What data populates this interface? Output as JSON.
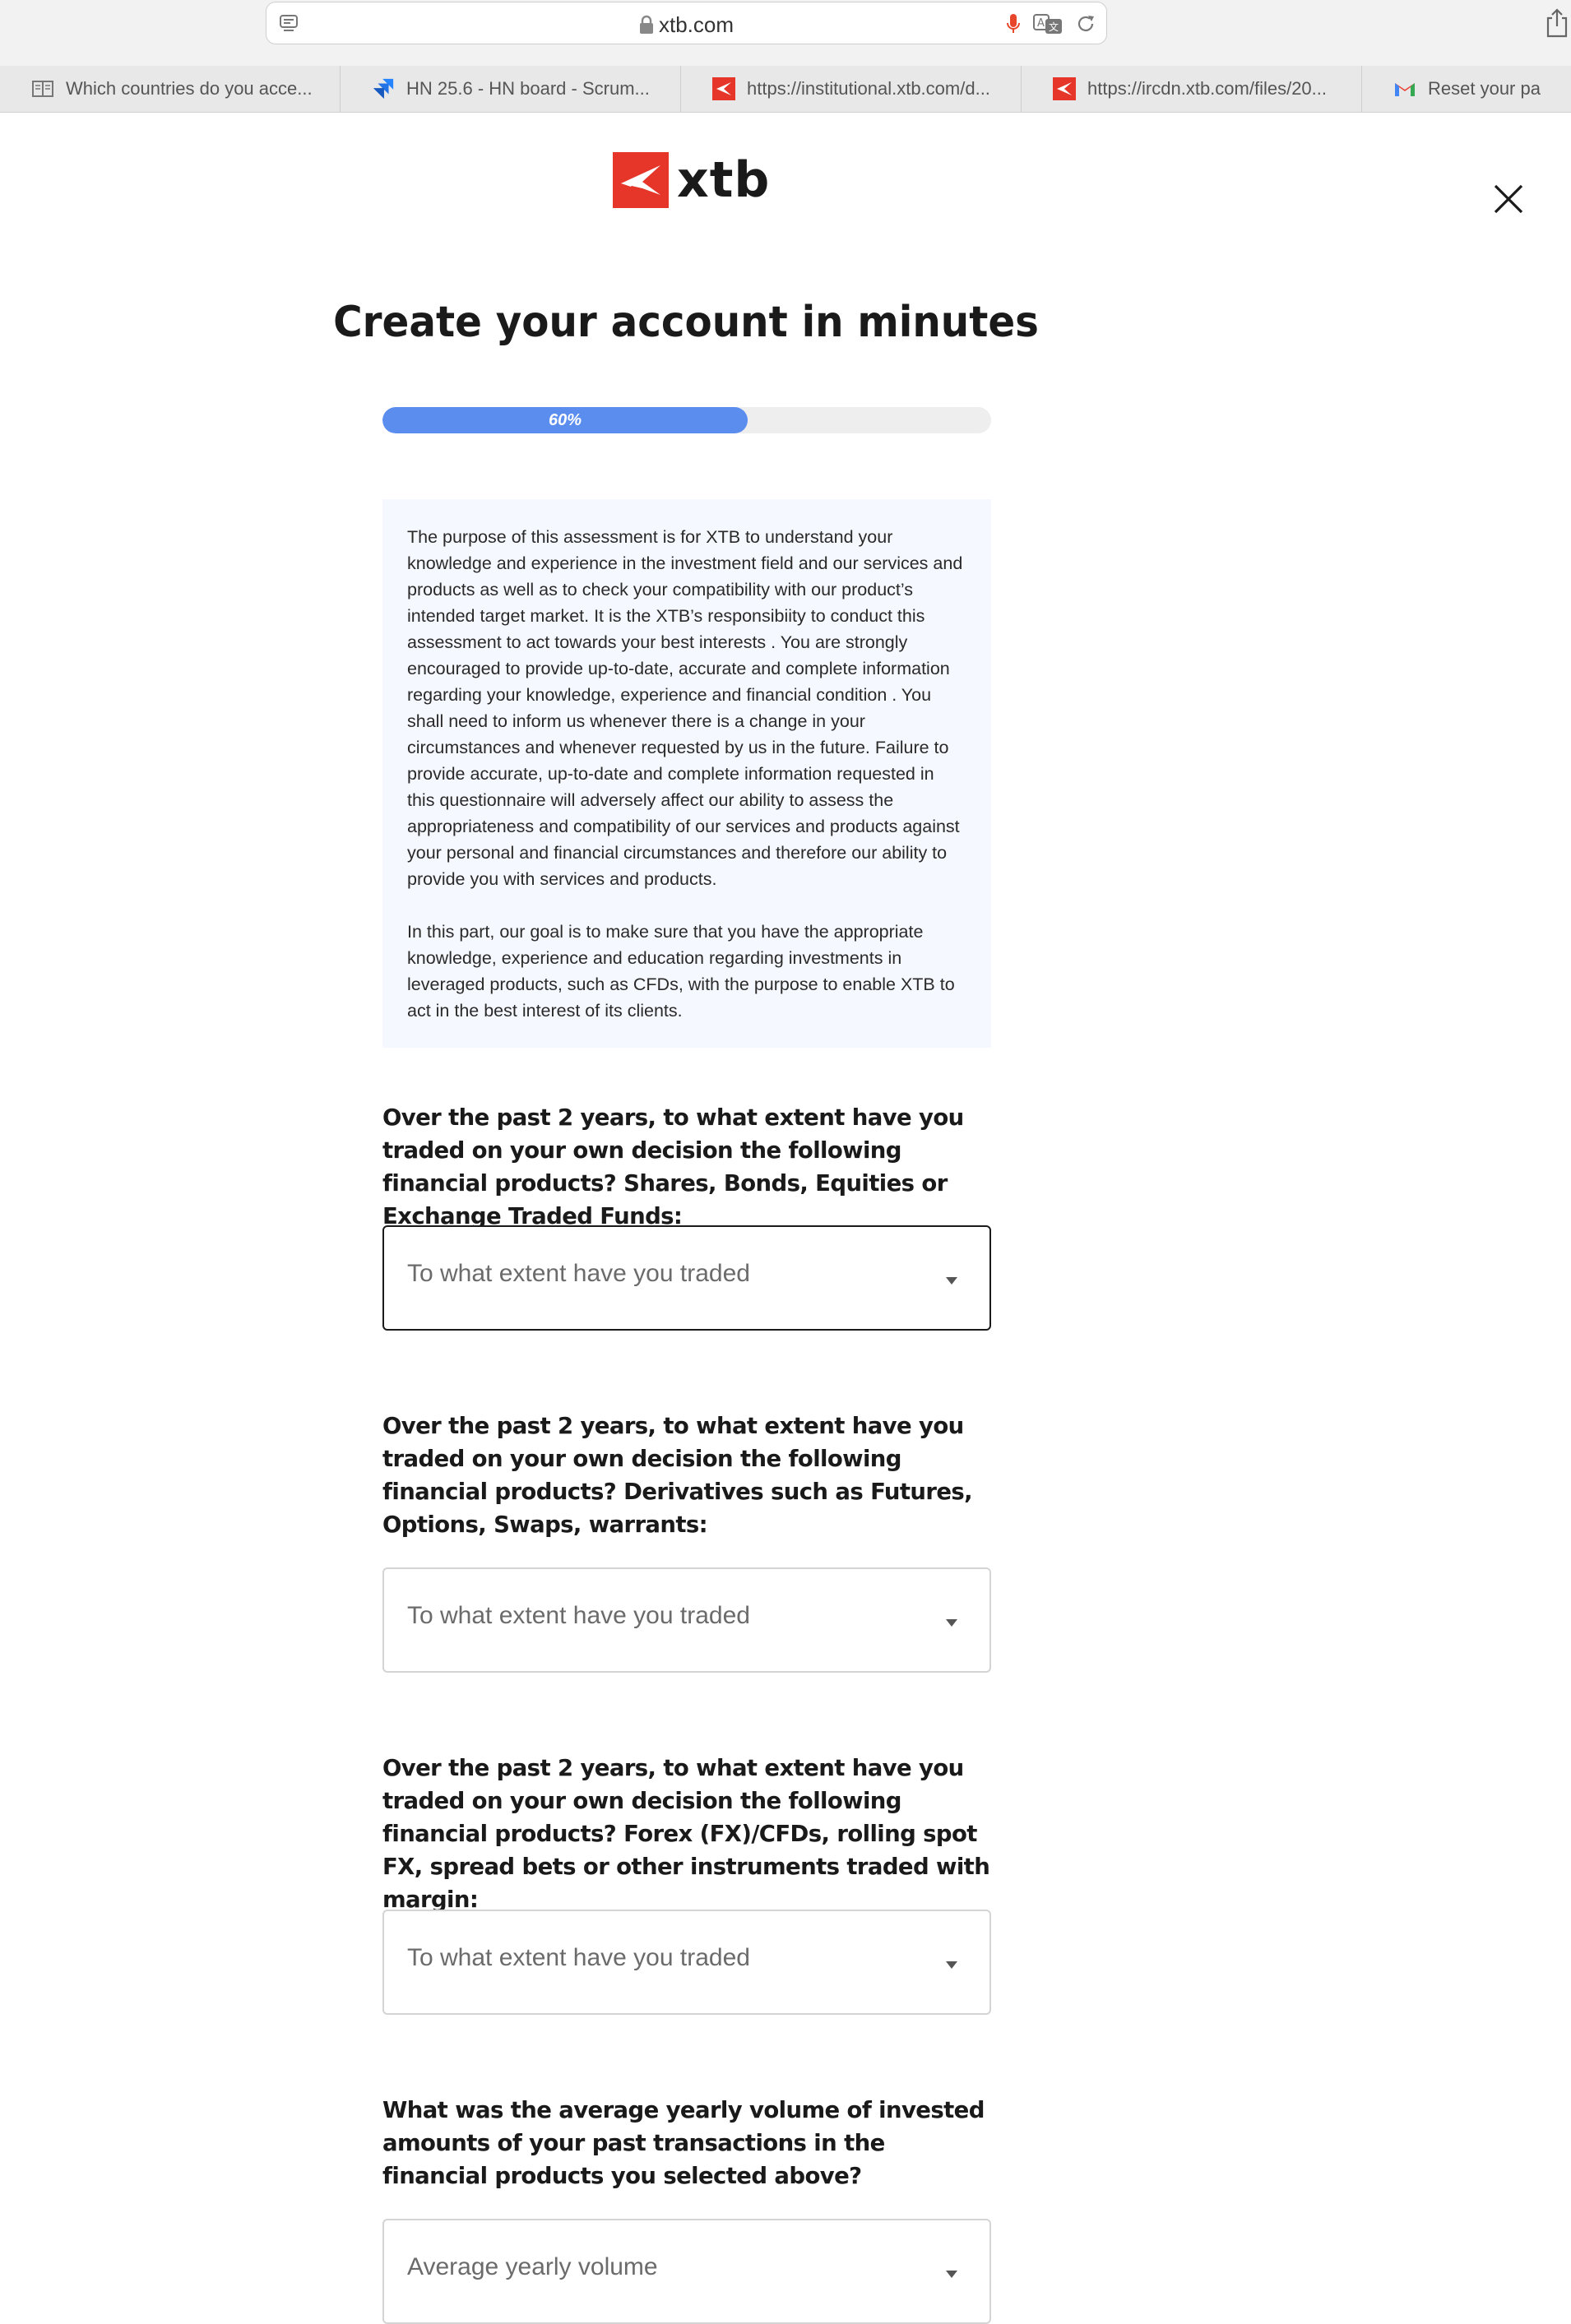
{
  "browser": {
    "url": "xtb.com",
    "tabs": [
      {
        "label": "Which countries do you acce...",
        "icon": "reader-icon"
      },
      {
        "label": "HN 25.6 - HN board - Scrum...",
        "icon": "jira-icon"
      },
      {
        "label": "https://institutional.xtb.com/d...",
        "icon": "xtb-icon"
      },
      {
        "label": "https://ircdn.xtb.com/files/20...",
        "icon": "xtb-icon"
      },
      {
        "label": "Reset your pa",
        "icon": "gmail-icon"
      }
    ]
  },
  "header": {
    "logo_text": "xtb",
    "title": "Create your account in minutes"
  },
  "progress": {
    "percent": 60,
    "label": "60%"
  },
  "info": {
    "paragraph1": "The purpose of this assessment is for XTB to understand your knowledge and experience in the investment field and our services and products as well as to check your compatibility with our product’s intended target market. It is the XTB’s responsibiity to conduct this assessment to act towards your best interests . You are strongly encouraged to provide up-to-date, accurate and complete information regarding your knowledge, experience and financial condition . You shall need to inform us whenever there is a change in your circumstances and whenever requested by us in the future. Failure to provide accurate, up-to-date and complete information requested in this questionnaire will adversely affect our ability to assess the appropriateness and compatibility of our services and products against your personal and financial circumstances and therefore our ability to provide you with services and products.",
    "paragraph2": "In this part, our goal is to make sure that you have the appropriate knowledge, experience and education regarding investments in leveraged products, such as CFDs, with the purpose to enable XTB to act in the best interest of its clients."
  },
  "questions": [
    {
      "text": "Over the past 2 years, to what extent have you traded on your own decision the following financial products? Shares, Bonds, Equities or Exchange Traded Funds:",
      "placeholder": "To what extent have you traded"
    },
    {
      "text": "Over the past 2 years, to what extent have you traded on your own decision the following financial products? Derivatives such as Futures, Options, Swaps, warrants:",
      "placeholder": "To what extent have you traded"
    },
    {
      "text": "Over the past 2 years, to what extent have you traded on your own decision the following financial products? Forex (FX)/CFDs, rolling spot FX, spread bets or other instruments traded with margin:",
      "placeholder": "To what extent have you traded"
    },
    {
      "text": "What was the average yearly volume of invested amounts of your past transactions in the financial products you selected above?",
      "placeholder": "Average yearly volume"
    }
  ],
  "colors": {
    "brand_red": "#e63529",
    "progress_blue": "#5b8def",
    "info_bg": "#f5f8fe"
  }
}
